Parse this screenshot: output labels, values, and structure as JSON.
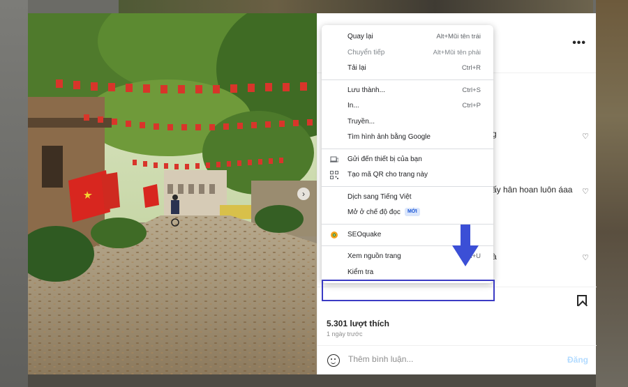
{
  "background": {
    "overlay_color": "#5a5a5a"
  },
  "post": {
    "likes_text": "5.301 lượt thích",
    "time_ago": "1 ngày trước",
    "comment_placeholder": "Thêm bình luận...",
    "post_label": "Đăng",
    "comment_fragments": [
      "g",
      "ấy hân hoan luôn áaa",
      "à"
    ]
  },
  "context_menu": {
    "groups": [
      [
        {
          "label": "Quay lại",
          "shortcut": "Alt+Mũi tên trái",
          "disabled": false
        },
        {
          "label": "Chuyển tiếp",
          "shortcut": "Alt+Mũi tên phải",
          "disabled": true
        },
        {
          "label": "Tải lại",
          "shortcut": "Ctrl+R",
          "disabled": false
        }
      ],
      [
        {
          "label": "Lưu thành...",
          "shortcut": "Ctrl+S",
          "disabled": false
        },
        {
          "label": "In...",
          "shortcut": "Ctrl+P",
          "disabled": false
        },
        {
          "label": "Truyền...",
          "shortcut": "",
          "disabled": false
        },
        {
          "label": "Tìm hình ảnh bằng Google",
          "shortcut": "",
          "disabled": false
        }
      ],
      [
        {
          "label": "Gửi đến thiết bị của bạn",
          "shortcut": "",
          "icon": "send-to-device-icon"
        },
        {
          "label": "Tạo mã QR cho trang này",
          "shortcut": "",
          "icon": "qr-code-icon"
        }
      ],
      [
        {
          "label": "Dịch sang Tiếng Việt",
          "shortcut": ""
        },
        {
          "label": "Mở ở chế độ đọc",
          "shortcut": "",
          "badge": "MỚI"
        }
      ],
      [
        {
          "label": "SEOquake",
          "shortcut": "",
          "icon": "seoquake-icon"
        }
      ],
      [
        {
          "label": "Xem nguồn trang",
          "shortcut": "Ctrl+U"
        },
        {
          "label": "Kiểm tra",
          "shortcut": ""
        }
      ]
    ]
  },
  "annotation": {
    "highlight_color": "#3b3bc4",
    "arrow_color": "#3b4fd6"
  }
}
